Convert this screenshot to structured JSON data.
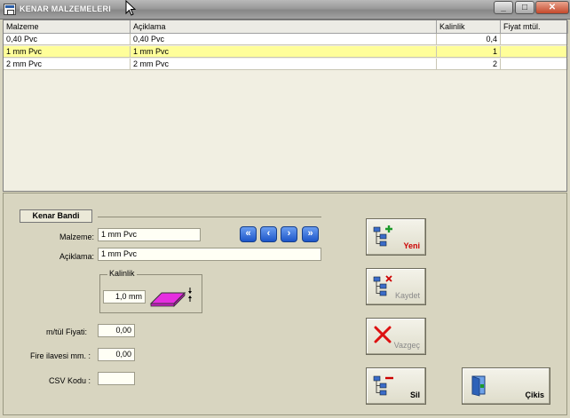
{
  "window": {
    "title": "KENAR MALZEMELERI"
  },
  "grid": {
    "columns": [
      "Malzeme",
      "Açiklama",
      "Kalinlik",
      "Fiyat mtül."
    ],
    "rows": [
      {
        "malzeme": "0,40 Pvc",
        "aciklama": "0,40 Pvc",
        "kalinlik": "0,4",
        "fiyat": "",
        "selected": false
      },
      {
        "malzeme": "1 mm Pvc",
        "aciklama": "1 mm Pvc",
        "kalinlik": "1",
        "fiyat": "",
        "selected": true
      },
      {
        "malzeme": "2 mm Pvc",
        "aciklama": "2 mm Pvc",
        "kalinlik": "2",
        "fiyat": "",
        "selected": false
      }
    ]
  },
  "form": {
    "section_title": "Kenar Bandi",
    "malzeme_label": "Malzeme:",
    "malzeme_value": "1 mm Pvc",
    "aciklama_label": "Açiklama:",
    "aciklama_value": "1 mm Pvc",
    "kalinlik_group": "Kalinlik",
    "kalinlik_value": "1,0 mm",
    "fiyat_label": "m/tül Fiyati:",
    "fiyat_value": "0,00",
    "fire_label": "Fire ilavesi mm. :",
    "fire_value": "0,00",
    "csv_label": "CSV Kodu :",
    "csv_value": ""
  },
  "nav": {
    "first": "«",
    "prev": "‹",
    "next": "›",
    "last": "»"
  },
  "actions": {
    "new_label": "Yeni",
    "save_label": "Kaydet",
    "cancel_label": "Vazgeç",
    "delete_label": "Sil",
    "exit_label": "Çikis"
  },
  "colors": {
    "selected_row": "#fffe99",
    "new_label": "#cc0000",
    "disabled_label": "#8a8a8a",
    "delete_icon": "#cc0000"
  }
}
